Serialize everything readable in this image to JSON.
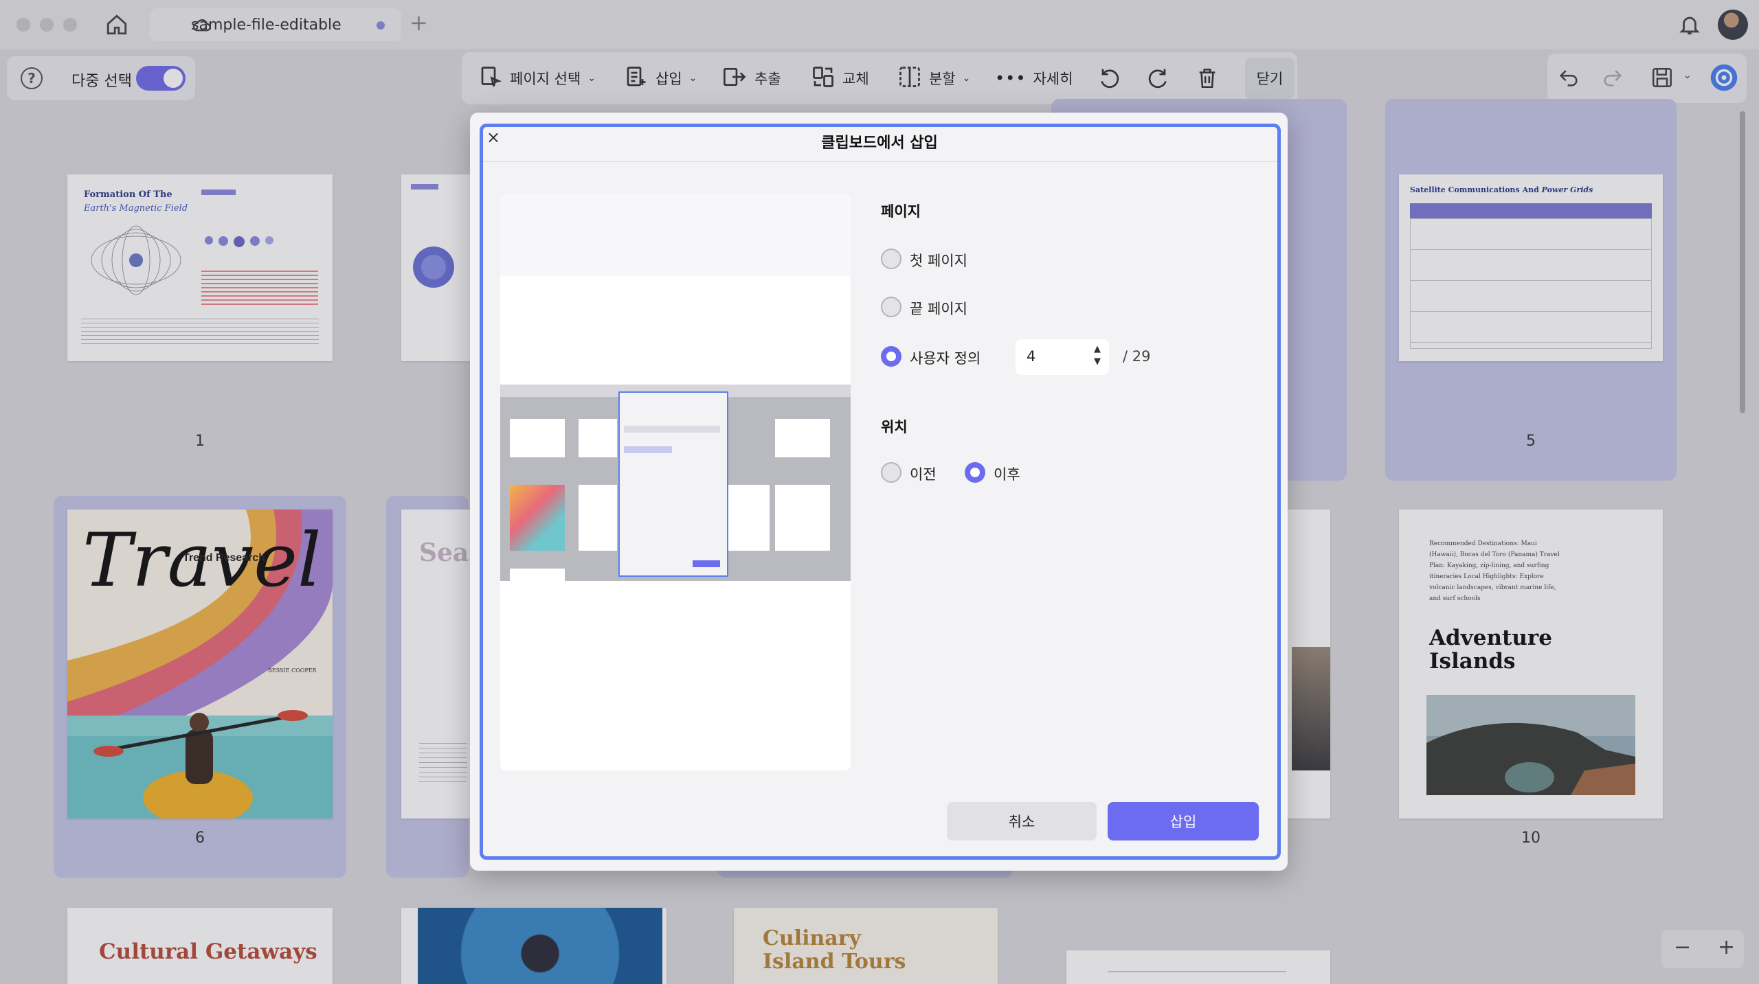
{
  "titlebar": {
    "tab_title": "sample-file-editable",
    "add_tab": "+"
  },
  "toolbar": {
    "multi_select_label": "다중 선택",
    "multi_select_on": true,
    "page_select": "페이지 선택",
    "insert": "삽입",
    "extract": "추출",
    "replace": "교체",
    "split": "분할",
    "more": "자세히",
    "close": "닫기"
  },
  "pages": [
    {
      "number": "1",
      "title": "Formation Of The",
      "subtitle": "Earth's Magnetic Field"
    },
    {
      "number": "5",
      "title": "Satellite Communications And",
      "subtitle": "Power Grids"
    },
    {
      "number": "6",
      "title": "Travel",
      "subtitle": "Trend Research",
      "author": "BESSIE COOPER"
    },
    {
      "number": "10",
      "title": "Adventure Islands",
      "text": "Recommended Destinations: Maui (Hawaii), Bocas del Toro (Panama) Travel Plan: Kayaking, zip-lining, and surfing itineraries Local Highlights: Explore volcanic landscapes, vibrant marine life, and surf schools"
    },
    {
      "number": "",
      "title": "Cultural Getaways"
    },
    {
      "number": "",
      "title": "Culinary Island Tours"
    },
    {
      "number": "",
      "title": "Seas"
    }
  ],
  "modal": {
    "title": "클립보드에서 삽입",
    "close_symbol": "×",
    "page_section": "페이지",
    "first_page": "첫 페이지",
    "last_page": "끝 페이지",
    "custom": "사용자 정의",
    "custom_value": "4",
    "total_pages": "/ 29",
    "selected_page_option": "custom",
    "position_section": "위치",
    "before": "이전",
    "after": "이후",
    "selected_position": "after",
    "cancel": "취소",
    "insert": "삽입"
  },
  "zoom": {
    "minus": "−",
    "plus": "+"
  },
  "colors": {
    "accent": "#6c6cf0",
    "modal_border": "#5c7ff0",
    "selected_card": "#c5c5e8"
  }
}
